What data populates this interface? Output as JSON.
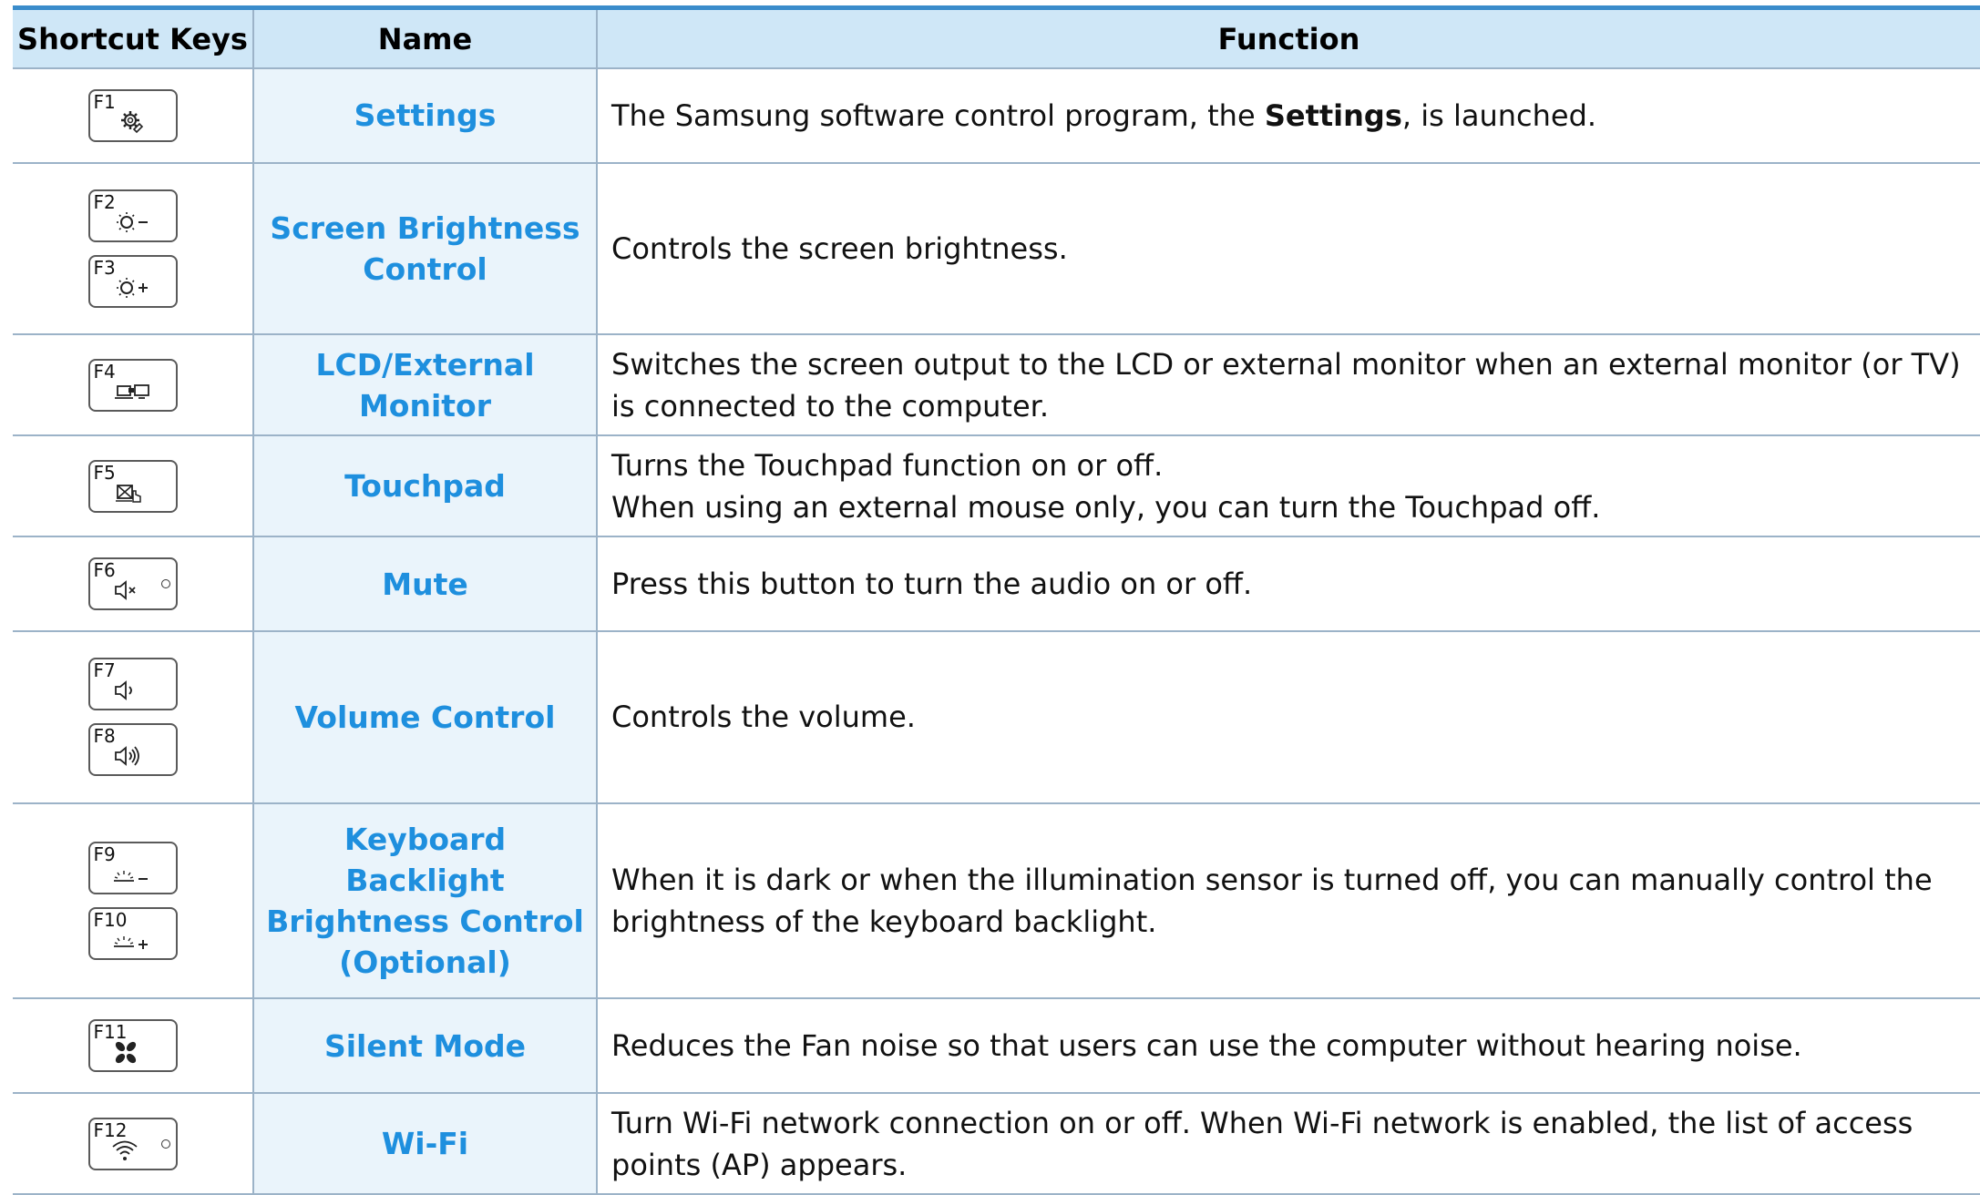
{
  "table": {
    "headers": {
      "keys": "Shortcut Keys",
      "name": "Name",
      "function": "Function"
    },
    "rows": [
      {
        "keys": [
          {
            "label": "F1",
            "icon": "settings-gear-icon"
          }
        ],
        "name": "Settings",
        "function": {
          "before": "The Samsung software control program, the ",
          "bold": "Settings",
          "after": ", is launched."
        }
      },
      {
        "keys": [
          {
            "label": "F2",
            "icon": "brightness-down-icon"
          },
          {
            "label": "F3",
            "icon": "brightness-up-icon"
          }
        ],
        "name": "Screen Brightness Control",
        "function": "Controls the screen brightness."
      },
      {
        "keys": [
          {
            "label": "F4",
            "icon": "lcd-external-monitor-icon"
          }
        ],
        "name": "LCD/External Monitor",
        "function": "Switches the screen output to the LCD or external monitor when an external monitor (or TV) is connected to the computer."
      },
      {
        "keys": [
          {
            "label": "F5",
            "icon": "touchpad-icon"
          }
        ],
        "name": "Touchpad",
        "function": {
          "line1": "Turns the Touchpad function on or off.",
          "line2": "When using an external mouse only, you can turn the Touchpad off."
        }
      },
      {
        "keys": [
          {
            "label": "F6",
            "icon": "mute-icon"
          }
        ],
        "name": "Mute",
        "function": "Press this button to turn the audio on or off."
      },
      {
        "keys": [
          {
            "label": "F7",
            "icon": "volume-down-icon"
          },
          {
            "label": "F8",
            "icon": "volume-up-icon"
          }
        ],
        "name": "Volume Control",
        "function": "Controls the volume."
      },
      {
        "keys": [
          {
            "label": "F9",
            "icon": "keyboard-backlight-down-icon"
          },
          {
            "label": "F10",
            "icon": "keyboard-backlight-up-icon"
          }
        ],
        "name": "Keyboard Backlight Brightness Control (Optional)",
        "function": "When it is dark or when the illumination sensor is turned off, you can manually control the brightness of the keyboard backlight."
      },
      {
        "keys": [
          {
            "label": "F11",
            "icon": "fan-icon"
          }
        ],
        "name": "Silent Mode",
        "function": "Reduces the Fan noise so that users can use the computer without hearing noise."
      },
      {
        "keys": [
          {
            "label": "F12",
            "icon": "wifi-icon"
          }
        ],
        "name": "Wi-Fi",
        "function": "Turn Wi-Fi network connection on or off. When Wi-Fi network is enabled, the list of access points (AP) appears."
      }
    ]
  }
}
